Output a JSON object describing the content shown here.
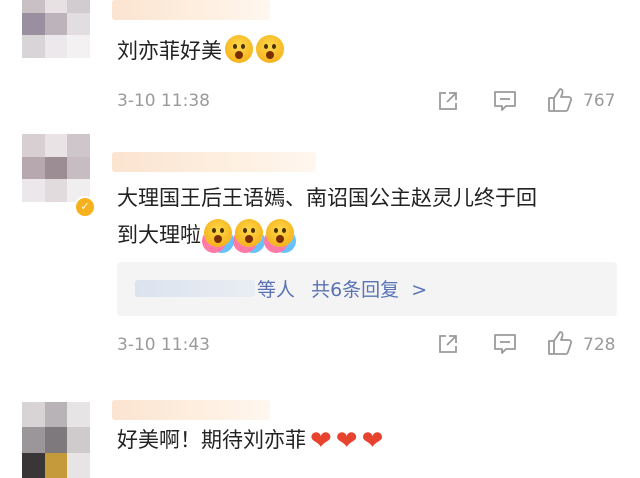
{
  "comments": [
    {
      "text": "刘亦菲好美",
      "emojis": [
        "scream",
        "scream"
      ],
      "time": "3-10 11:38",
      "likes": "767"
    },
    {
      "text_line1": "大理国王后王语嫣、南诏国公主赵灵儿终于回",
      "text_line2": "到大理啦",
      "emojis": [
        "cheer",
        "cheer",
        "cheer"
      ],
      "reply_prefix": "等人",
      "reply_count": "共6条回复",
      "reply_arrow": ">",
      "time": "3-10 11:43",
      "likes": "728"
    },
    {
      "text": "好美啊！期待刘亦菲",
      "emojis": [
        "heart",
        "heart",
        "heart"
      ]
    }
  ],
  "icons": {
    "share": "share-icon",
    "comment": "comment-icon",
    "like": "thumbs-up-icon"
  },
  "colors": {
    "link": "#5a73b5",
    "meta": "#9a9a9a",
    "badge": "#f5b21c",
    "heart": "#e8432f"
  }
}
